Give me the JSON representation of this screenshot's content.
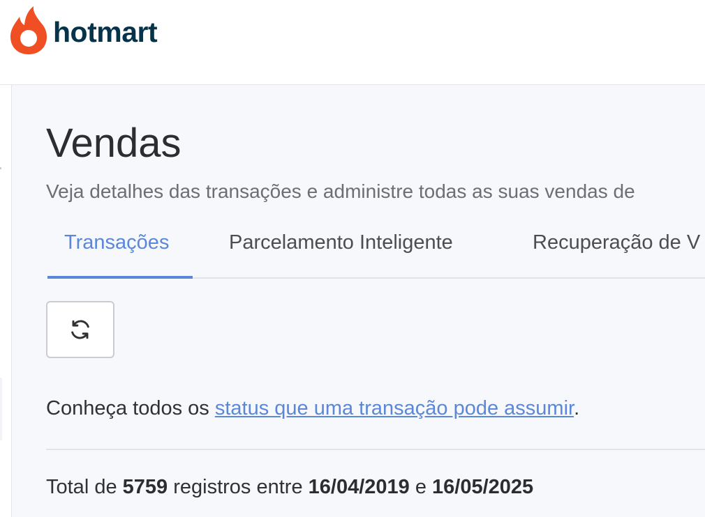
{
  "brand": {
    "name": "hotmart",
    "colors": {
      "flame": "#F04E23",
      "text": "#053349"
    }
  },
  "page": {
    "title": "Vendas",
    "subtitle": "Veja detalhes das transações e administre todas as suas vendas de"
  },
  "tabs": [
    {
      "label": "Transações",
      "active": true
    },
    {
      "label": "Parcelamento Inteligente",
      "active": false
    },
    {
      "label": "Recuperação de V",
      "active": false
    }
  ],
  "toolbar": {
    "refresh_icon": "refresh-icon"
  },
  "info": {
    "prefix": "Conheça todos os ",
    "link": "status que uma transação pode assumir",
    "suffix": "."
  },
  "summary": {
    "prefix": "Total de ",
    "count": "5759",
    "middle": " registros entre ",
    "start_date": "16/04/2019",
    "connector": " e ",
    "end_date": "16/05/2025"
  },
  "colors": {
    "accent": "#5B87D9",
    "background": "#F6F8FB"
  }
}
